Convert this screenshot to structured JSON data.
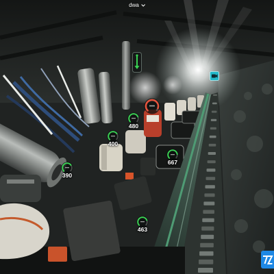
{
  "app": {
    "title": "dwa"
  },
  "icons": {
    "title_dropdown": "chevron-down-icon",
    "level_hotspot": "level-indicator-icon",
    "camera_hotspot": "camera-icon",
    "brand_logo": "logo"
  },
  "colors": {
    "gauge_ok": "#39d353",
    "gauge_alarm": "#e5533d",
    "camera_accent": "#22b8c8",
    "logo_blue": "#1e88e5"
  },
  "gauges": [
    {
      "value": "390",
      "status": "ok",
      "fill": 0.7
    },
    {
      "value": "400",
      "status": "ok",
      "fill": 0.7
    },
    {
      "value": "480",
      "status": "ok",
      "fill": 0.75
    },
    {
      "value": "",
      "status": "alarm",
      "fill": 0.9
    },
    {
      "value": "667",
      "status": "ok",
      "fill": 0.8
    },
    {
      "value": "463",
      "status": "ok",
      "fill": 0.75
    }
  ]
}
